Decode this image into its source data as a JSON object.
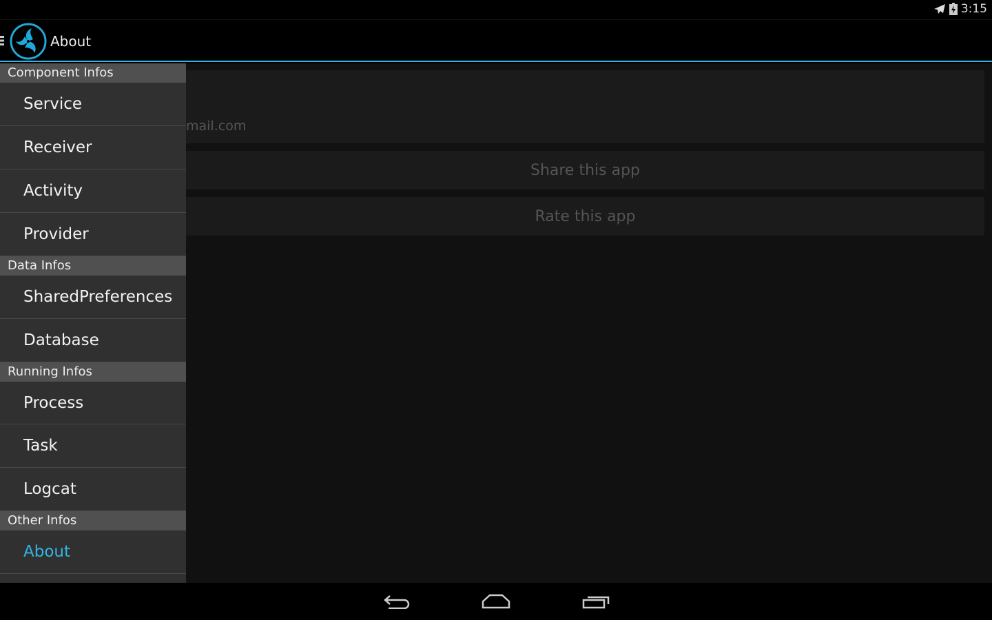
{
  "status": {
    "time": "3:15",
    "icons": [
      "airplane-mode-icon",
      "battery-charging-icon"
    ]
  },
  "actionbar": {
    "title": "About",
    "accent": "#33b5e5"
  },
  "content": {
    "email_fragment": "mail.com",
    "share_label": "Share this app",
    "rate_label": "Rate this app"
  },
  "drawer": {
    "sections": [
      {
        "header": "Component Infos",
        "items": [
          "Service",
          "Receiver",
          "Activity",
          "Provider"
        ]
      },
      {
        "header": "Data Infos",
        "items": [
          "SharedPreferences",
          "Database"
        ]
      },
      {
        "header": "Running Infos",
        "items": [
          "Process",
          "Task",
          "Logcat"
        ]
      },
      {
        "header": "Other Infos",
        "items": [
          "About"
        ]
      }
    ],
    "active": "About"
  },
  "nav": [
    "back-icon",
    "home-icon",
    "recents-icon"
  ]
}
